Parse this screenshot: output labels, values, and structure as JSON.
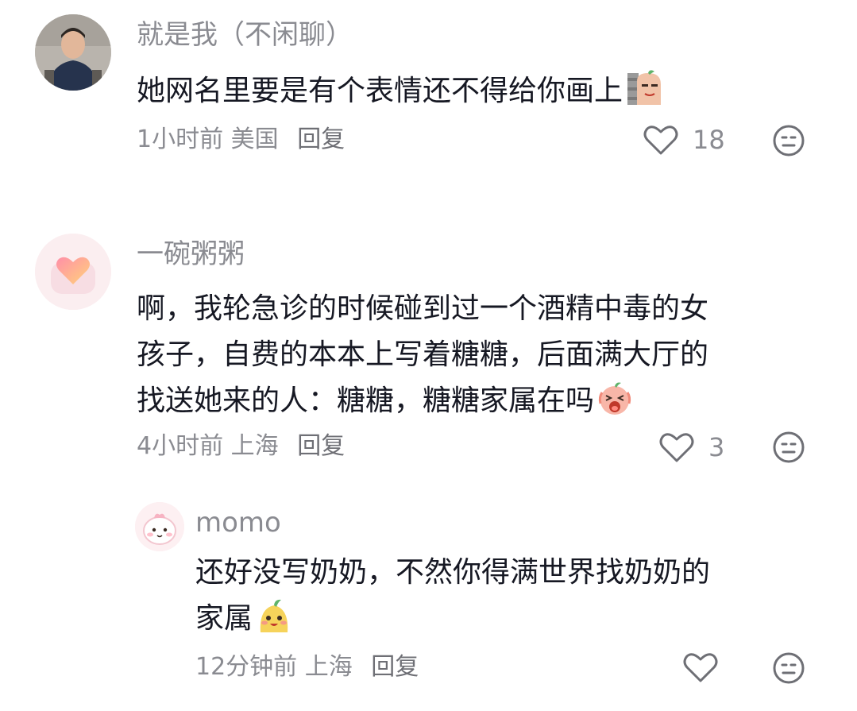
{
  "comments": [
    {
      "username": "就是我（不闲聊）",
      "text": "她网名里要是有个表情还不得给你画上",
      "time": "1小时前",
      "location": "美国",
      "reply_label": "回复",
      "likes": "18",
      "emoji": "peek-emoji"
    },
    {
      "username": "一碗粥粥",
      "text_lines": [
        "啊，我轮急诊的时候碰到过一个酒精中毒的女",
        "孩子，自费的本本上写着糖糖，后面满大厅的",
        "找送她来的人：糖糖，糖糖家属在吗"
      ],
      "time": "4小时前",
      "location": "上海",
      "reply_label": "回复",
      "likes": "3",
      "emoji": "shout-emoji"
    },
    {
      "username": "momo",
      "text_lines": [
        "还好没写奶奶，不然你得满世界找奶奶的",
        "家属"
      ],
      "time": "12分钟前",
      "location": "上海",
      "reply_label": "回复",
      "likes": "",
      "emoji": "happy-emoji"
    }
  ],
  "colors": {
    "secondary_text": "#8a8b91",
    "primary_text": "#161823",
    "icon_stroke": "#6e6f75"
  }
}
